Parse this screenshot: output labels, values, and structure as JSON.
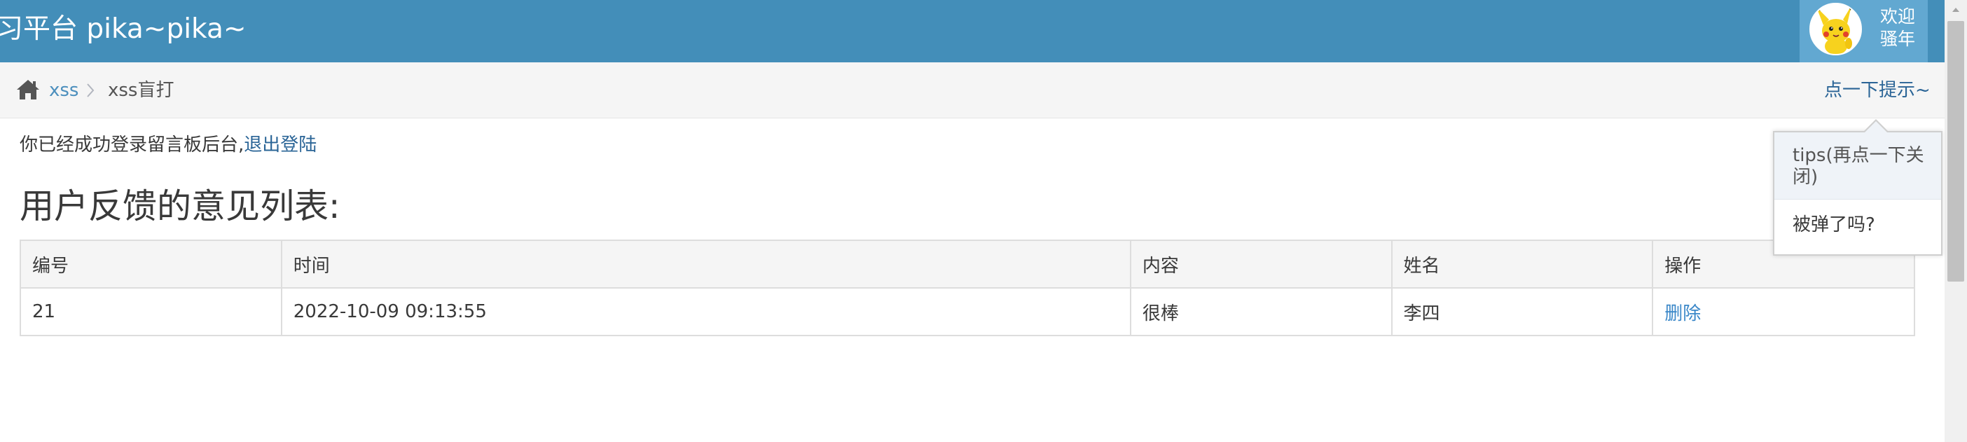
{
  "header": {
    "brand": "习平台 pika~pika~",
    "user_greeting_line1": "欢迎",
    "user_greeting_line2": "骚年"
  },
  "breadcrumbs": {
    "items": [
      {
        "label": "xss"
      },
      {
        "label": "xss盲打"
      }
    ],
    "tip_link": "点一下提示~"
  },
  "popover": {
    "title": "tips(再点一下关闭)",
    "content": "被弹了吗?"
  },
  "main": {
    "login_message": "你已经成功登录留言板后台,",
    "logout_link": "退出登陆",
    "page_title": "用户反馈的意见列表:"
  },
  "table": {
    "headers": [
      "编号",
      "时间",
      "内容",
      "姓名",
      "操作"
    ],
    "rows": [
      {
        "id": "21",
        "time": "2022-10-09 09:13:55",
        "content": "很棒",
        "name": "李四",
        "action": "删除"
      }
    ]
  },
  "colors": {
    "navbar": "#438eb9",
    "user_box": "#62a8d1",
    "link": "#2a6496"
  }
}
